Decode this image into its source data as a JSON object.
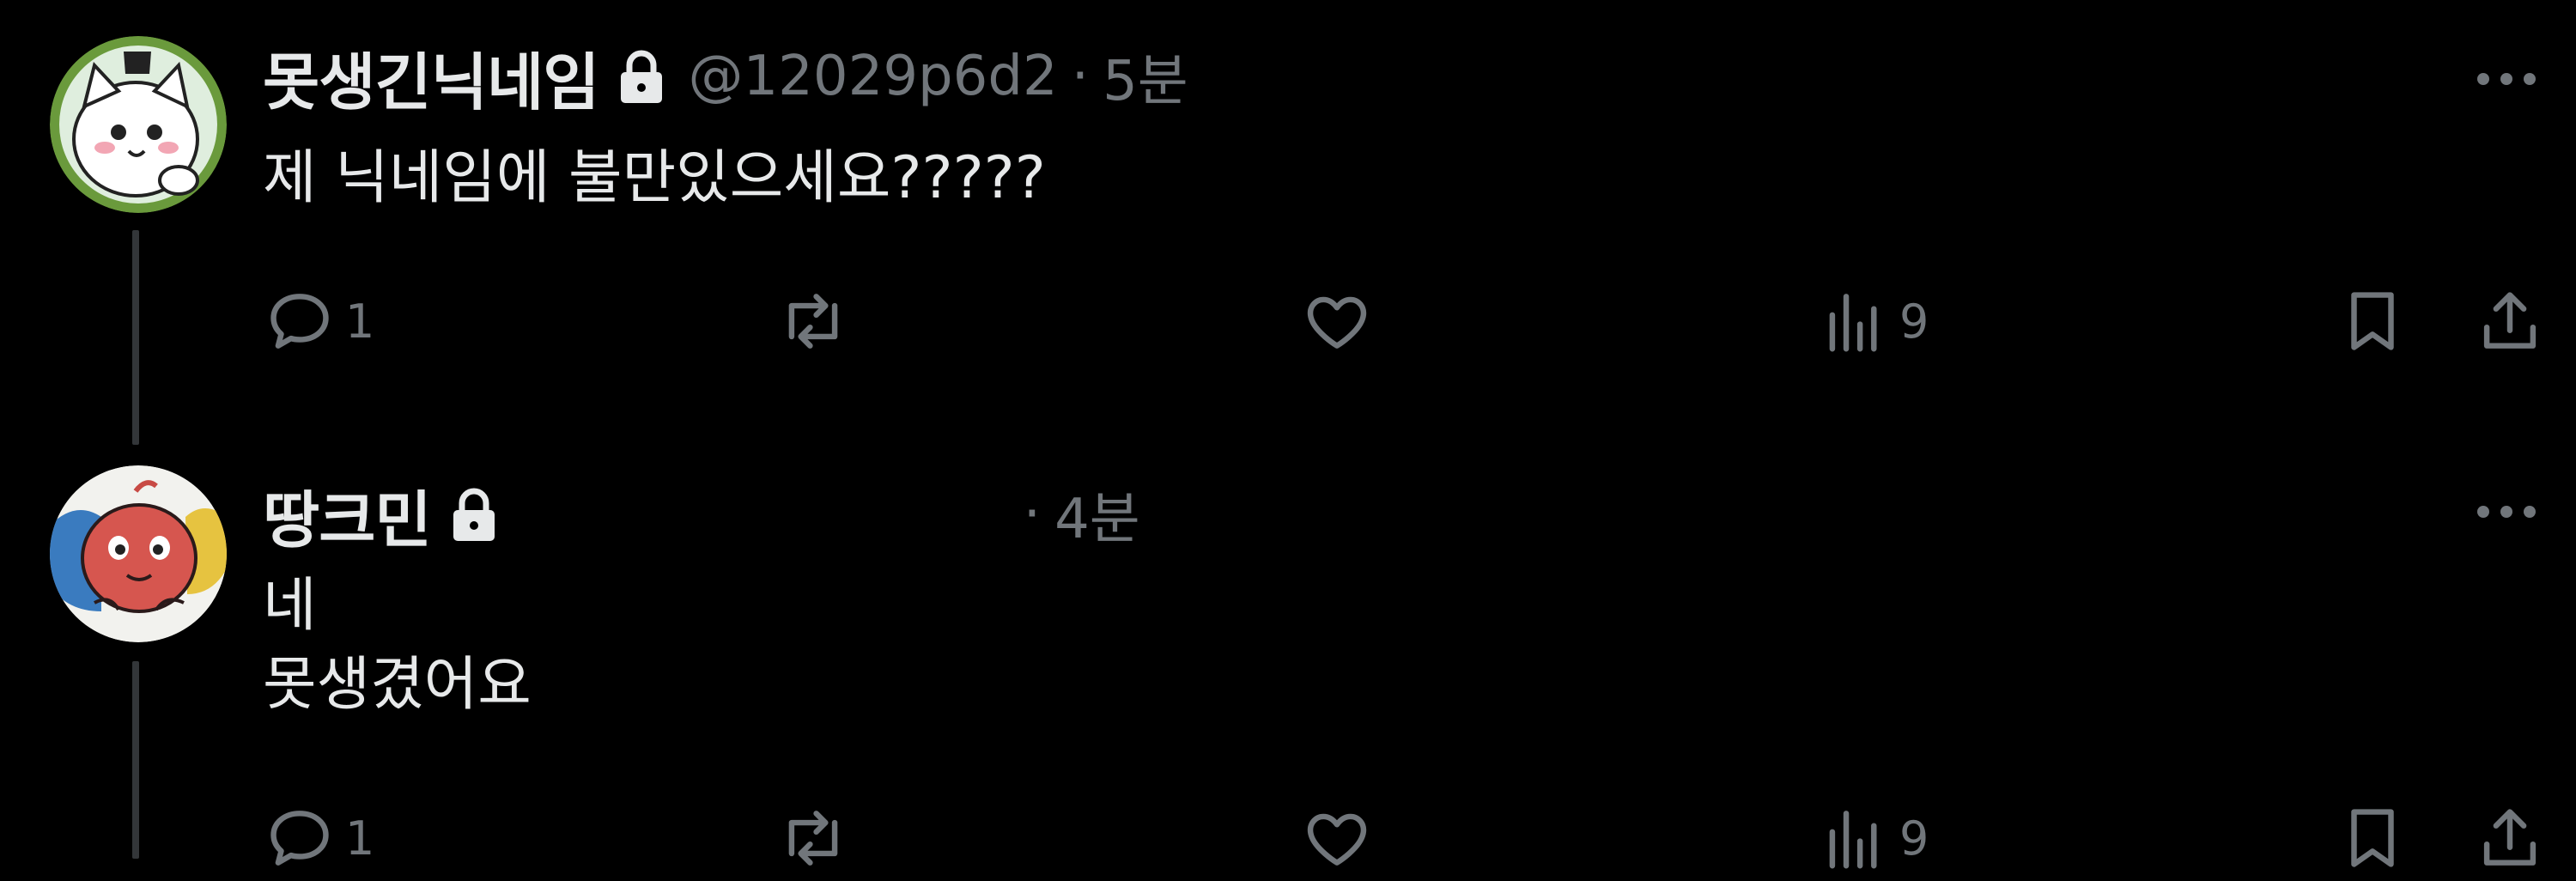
{
  "tweets": [
    {
      "name": "못생긴닉네임",
      "handle": "@12029p6d2",
      "separator": "·",
      "time": "5분",
      "lines": [
        "제 닉네임에 불만있으세요?????"
      ],
      "reply_count": "1",
      "retweet_count": "",
      "like_count": "",
      "view_count": "9"
    },
    {
      "name": "땅크민",
      "handle": "",
      "separator": "·",
      "time": "4분",
      "lines": [
        "네",
        "못생겼어요"
      ],
      "reply_count": "1",
      "retweet_count": "",
      "like_count": "",
      "view_count": "9"
    }
  ],
  "icons": {
    "avatar1": "cat-avatar-icon",
    "avatar2": "red-creature-avatar-icon",
    "lock": "lock-icon",
    "more": "more-dots-icon",
    "reply": "reply-icon",
    "retweet": "retweet-icon",
    "like": "heart-icon",
    "views": "views-chart-icon",
    "bookmark": "bookmark-icon",
    "share": "share-icon"
  },
  "colors": {
    "background": "#000000",
    "text_primary": "#e7e9ea",
    "text_secondary": "#71767b",
    "thread_line": "#333639"
  }
}
